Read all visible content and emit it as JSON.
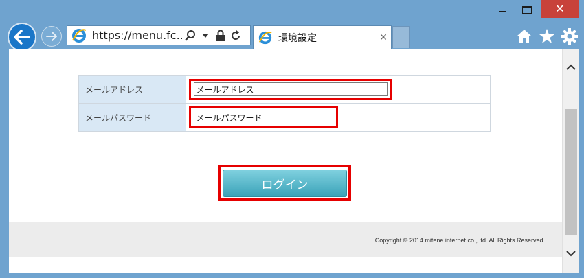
{
  "browser": {
    "url": "https://menu.fc...",
    "tab_title": "環境設定",
    "tab_close_glyph": "✕",
    "close_glyph": "✕"
  },
  "form": {
    "email_label": "メールアドレス",
    "email_value": "メールアドレス",
    "password_label": "メールパスワード",
    "password_value": "メールパスワード",
    "login_label": "ログイン"
  },
  "footer": {
    "copyright": "Copyright © 2014 mitene internet co., ltd. All Rights Reserved."
  },
  "colors": {
    "highlight": "#e60000",
    "button_top": "#7fd0df",
    "button_bottom": "#3ba3b8",
    "label_bg": "#d9e8f5"
  }
}
